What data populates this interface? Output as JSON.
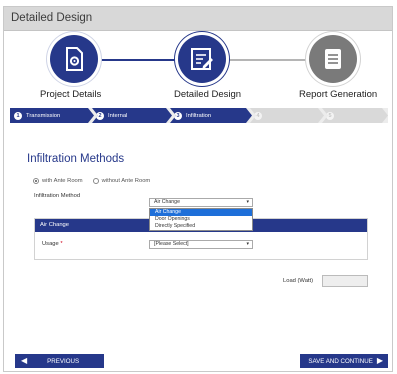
{
  "window": {
    "title": "Detailed Design"
  },
  "wizard": {
    "steps": [
      {
        "label": "Project Details",
        "icon": "document-gear-icon",
        "state": "done"
      },
      {
        "label": "Detailed Design",
        "icon": "edit-document-icon",
        "state": "active"
      },
      {
        "label": "Report Generation",
        "icon": "report-list-icon",
        "state": "todo"
      }
    ]
  },
  "tabs": [
    {
      "num": "1",
      "label": "Transmission",
      "state": "done"
    },
    {
      "num": "2",
      "label": "Internal",
      "state": "done"
    },
    {
      "num": "3",
      "label": "Infiltration",
      "state": "active"
    },
    {
      "num": "4",
      "label": "",
      "state": "inactive"
    },
    {
      "num": "5",
      "label": "",
      "state": "inactive"
    }
  ],
  "form": {
    "heading": "Infiltration Methods",
    "radio_with_ante": "with Ante Room",
    "radio_without_ante": "without Ante Room",
    "method_label": "Infiltration Method",
    "method_value": "Air Change",
    "method_options": [
      "Air Change",
      "Door Openings",
      "Directly Specified"
    ],
    "method_highlighted": "Air Change",
    "panel_title": "Air Change",
    "usage_label": "Usage",
    "usage_required_mark": "*",
    "usage_value": "[Please Select]",
    "load_label": "Load (Watt)",
    "load_value": ""
  },
  "buttons": {
    "previous": "PREVIOUS",
    "save_continue": "SAVE AND CONTINUE"
  },
  "colors": {
    "accent": "#26388a",
    "pending": "#7a7a7a",
    "highlight": "#1e6fd9"
  }
}
